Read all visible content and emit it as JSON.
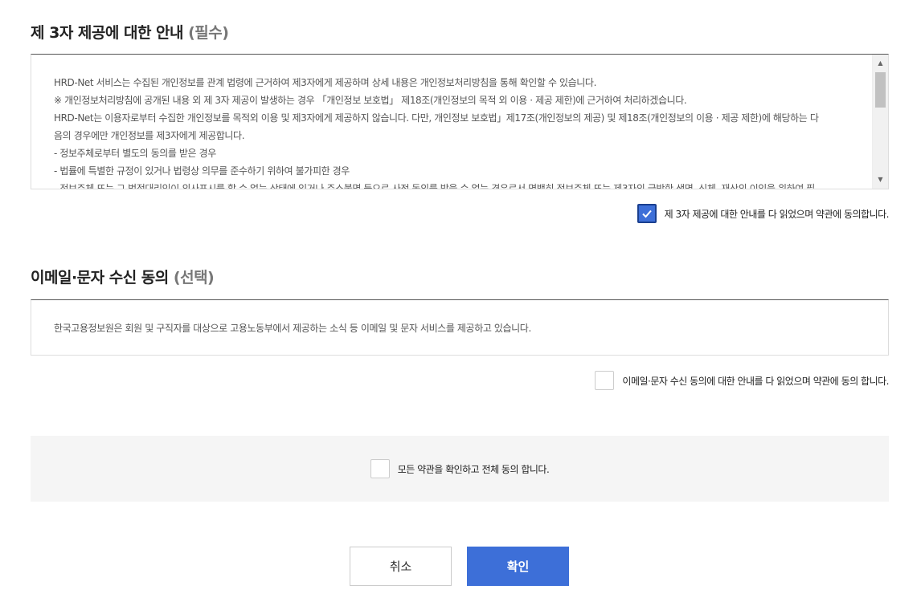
{
  "third_party": {
    "title": "제 3자 제공에 대한 안내",
    "tag": "(필수)",
    "lines": [
      "HRD-Net 서비스는 수집된 개인정보를 관계 법령에 근거하여 제3자에게 제공하며 상세 내용은 개인정보처리방침을 통해 확인할 수 있습니다.",
      "※ 개인정보처리방침에 공개된 내용 외 제 3자 제공이 발생하는 경우 「개인정보 보호법」 제18조(개인정보의 목적 외 이용 · 제공 제한)에 근거하여 처리하겠습니다.",
      "HRD-Net는 이용자로부터 수집한 개인정보를 목적외 이용 및 제3자에게 제공하지 않습니다. 다만, 개인정보 보호법」제17조(개인정보의 제공) 및 제18조(개인정보의 이용 · 제공 제한)에 해당하는 다",
      "음의 경우에만 개인정보를 제3자에게 제공합니다.",
      "- 정보주체로부터 별도의 동의를 받은 경우",
      "- 법률에 특별한 규정이 있거나 법령상 의무를 준수하기 위하여 불가피한 경우",
      "- 정보주체 또는 그 법정대리인이 의사표시를 할 수 없는 상태에 있거나 주소불명 등으로 사전 동의를 받을 수 없는 경우로서 명백히 정보주체 또는 제3자의 급박한 생명, 신체, 재산의 이익을 위하여 필"
    ],
    "agree_label": "제 3자 제공에 대한 안내를 다 읽었으며 약관에 동의합니다.",
    "agreed": true
  },
  "email_sms": {
    "title": "이메일·문자 수신 동의",
    "tag": "(선택)",
    "content": "한국고용정보원은 회원 및 구직자를 대상으로 고용노동부에서 제공하는 소식 등 이메일 및 문자 서비스를 제공하고 있습니다.",
    "agree_label": "이메일·문자 수신 동의에 대한 안내를 다 읽었으며 약관에 동의 합니다.",
    "agreed": false
  },
  "all_agree": {
    "label": "모든 약관을 확인하고 전체 동의 합니다.",
    "agreed": false
  },
  "buttons": {
    "cancel": "취소",
    "confirm": "확인"
  },
  "colors": {
    "primary": "#3d6fd8",
    "border_dark": "#555555",
    "panel_bg": "#f5f5f5"
  },
  "icons": {
    "checkmark": "checkmark-icon",
    "scroll_up": "triangle-up-icon",
    "scroll_down": "triangle-down-icon"
  }
}
